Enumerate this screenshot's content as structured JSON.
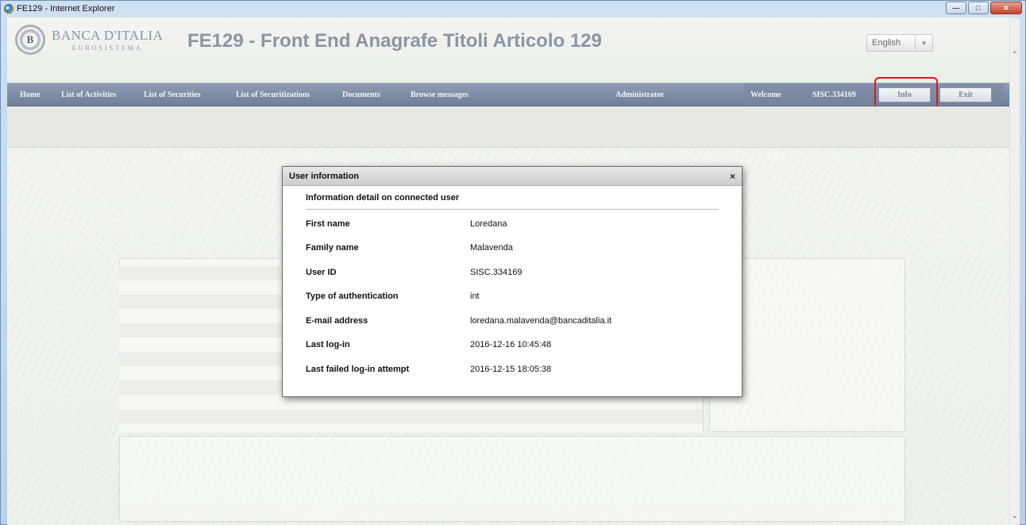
{
  "window": {
    "title": "FE129 - Internet Explorer",
    "controls": {
      "minimize": "—",
      "maximize": "□",
      "close": "✕"
    }
  },
  "header": {
    "logo_line1": "BANCA D'ITALIA",
    "logo_line2": "EUROSISTEMA",
    "logo_seal": "B",
    "app_title": "FE129 - Front End Anagrafe Titoli Articolo 129",
    "language": {
      "selected": "English",
      "arrow": "▼"
    }
  },
  "nav": {
    "items": [
      {
        "label": "Home"
      },
      {
        "label": "List of Activities"
      },
      {
        "label": "List of Securities"
      },
      {
        "label": "List of Securitizations"
      },
      {
        "label": "Documents"
      },
      {
        "label": "Browse messages"
      },
      {
        "label": "Administrator"
      }
    ],
    "welcome_label": "Welcome",
    "user_id": "SISC.334169",
    "info_button": "Info",
    "exit_button": "Exit"
  },
  "dialog": {
    "title": "User information",
    "close": "×",
    "section_title": "Information detail on connected user",
    "fields": [
      {
        "label": "First name",
        "value": "Loredana"
      },
      {
        "label": "Family name",
        "value": "Malavenda"
      },
      {
        "label": "User ID",
        "value": "SISC.334169"
      },
      {
        "label": "Type of authentication",
        "value": "int"
      },
      {
        "label": "E-mail address",
        "value": "loredana.malavenda@bancaditalia.it"
      },
      {
        "label": "Last log-in",
        "value": "2016-12-16 10:45:48"
      },
      {
        "label": "Last failed log-in attempt",
        "value": "2016-12-15 18:05:38"
      }
    ]
  },
  "scrollbar": {
    "up": "⌃",
    "down": "⌄"
  },
  "colors": {
    "highlight": "#e3161b",
    "navbar": "#7d8ca5"
  }
}
